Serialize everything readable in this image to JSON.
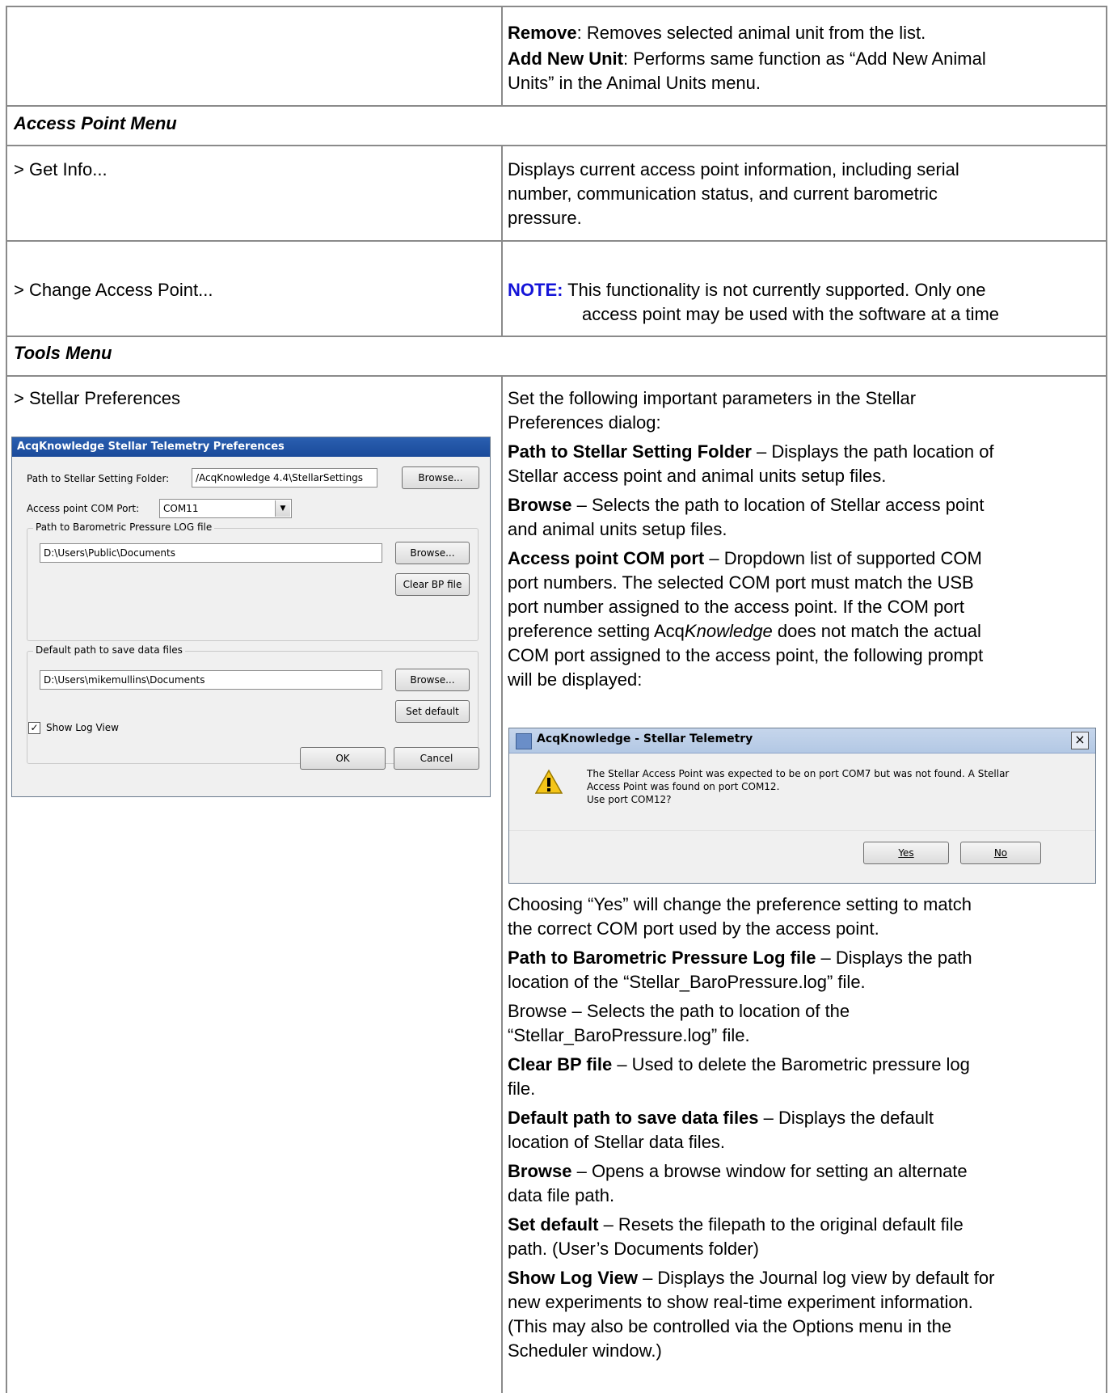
{
  "rows": {
    "remove_term": "Remove",
    "remove_desc": ": Removes selected animal unit from the list.",
    "add_new_term": "Add New Unit",
    "add_new_desc_1": ": Performs same function as “Add New Animal",
    "add_new_desc_2": "Units” in the Animal Units menu.",
    "access_point_menu": "Access Point Menu",
    "get_info": "> Get Info...",
    "get_info_desc": [
      "Displays current access point information, including serial",
      "number, communication status, and current barometric",
      "pressure."
    ],
    "change_access_point": "> Change Access Point...",
    "note_label": "NOTE:",
    "note_desc_1": " This functionality is not currently supported. Only one",
    "note_desc_2": "access point may be used with the software at a time",
    "tools_menu": "Tools  Menu",
    "stellar_preferences": "> Stellar Preferences"
  },
  "prefs_dialog": {
    "title": "AcqKnowledge Stellar Telemetry Preferences",
    "path_label": "Path to Stellar Setting Folder:",
    "path_value": "/AcqKnowledge 4.4\\StellarSettings",
    "browse": "Browse...",
    "com_label": "Access point COM Port:",
    "com_value": "COM11",
    "baro_group": "Path to Barometric Pressure LOG file",
    "baro_value": "D:\\Users\\Public\\Documents",
    "clear_bp": "Clear BP file",
    "default_group": "Default path to save data files",
    "default_value": "D:\\Users\\mikemullins\\Documents",
    "set_default": "Set default",
    "show_log": "Show Log View",
    "ok": "OK",
    "cancel": "Cancel"
  },
  "prompt_dialog": {
    "title": "AcqKnowledge - Stellar Telemetry",
    "close": "×",
    "message_1": "The Stellar Access Point was expected to be on port COM7 but was not found.  A Stellar",
    "message_2": "Access Point was found on port COM12.",
    "message_3": "Use port COM12?",
    "yes": "Yes",
    "no": "No"
  },
  "right_text": {
    "intro_1": "Set the following important parameters in the Stellar",
    "intro_2": "Preferences dialog:",
    "p1_term": "Path to Stellar Setting Folder",
    "p1_a": " – Displays the path location of",
    "p1_b": "Stellar access point and animal units setup files.",
    "p2_term": "Browse",
    "p2_a": " – Selects the path to location of Stellar access point",
    "p2_b": "and animal units setup files.",
    "p3_term": "Access point COM port",
    "p3_a": " – Dropdown list of supported COM",
    "p3_b": "port numbers. The selected COM port must match the USB",
    "p3_c": "port number assigned to the access point. If the COM port",
    "p3_d1": "preference setting Acq",
    "p3_d2": "Knowledge",
    "p3_d3": " does not match the actual",
    "p3_e": "COM port assigned to the access point, the following prompt",
    "p3_f": "will be displayed:",
    "p4_a": "Choosing “Yes” will change the preference setting to match",
    "p4_b": "the correct COM port used by the access point.",
    "p5_term": "Path to Barometric Pressure Log file",
    "p5_a": " – Displays the path",
    "p5_b": "location of the “Stellar_BaroPressure.log” file.",
    "p6_a": "Browse – Selects the path to location of the",
    "p6_b": "“Stellar_BaroPressure.log” file.",
    "p7_term": "Clear BP file",
    "p7_a": " – Used to delete the Barometric pressure log",
    "p7_b": "file.",
    "p8_term": "Default path to save data files",
    "p8_a": " – Displays the default",
    "p8_b": "location of Stellar data files.",
    "p9_term": "Browse",
    "p9_a": " – Opens a browse window for setting an alternate",
    "p9_b": "data file path.",
    "p10_term": "Set default",
    "p10_a": " – Resets the filepath to the original default file",
    "p10_b": "path. (User’s Documents folder)",
    "p11_term": "Show Log View",
    "p11_a": " – Displays the Journal log view by default for",
    "p11_b": "new experiments to show real-time experiment information.",
    "p11_c": "(This may also be controlled via the Options menu in the",
    "p11_d": "Scheduler window.)"
  }
}
